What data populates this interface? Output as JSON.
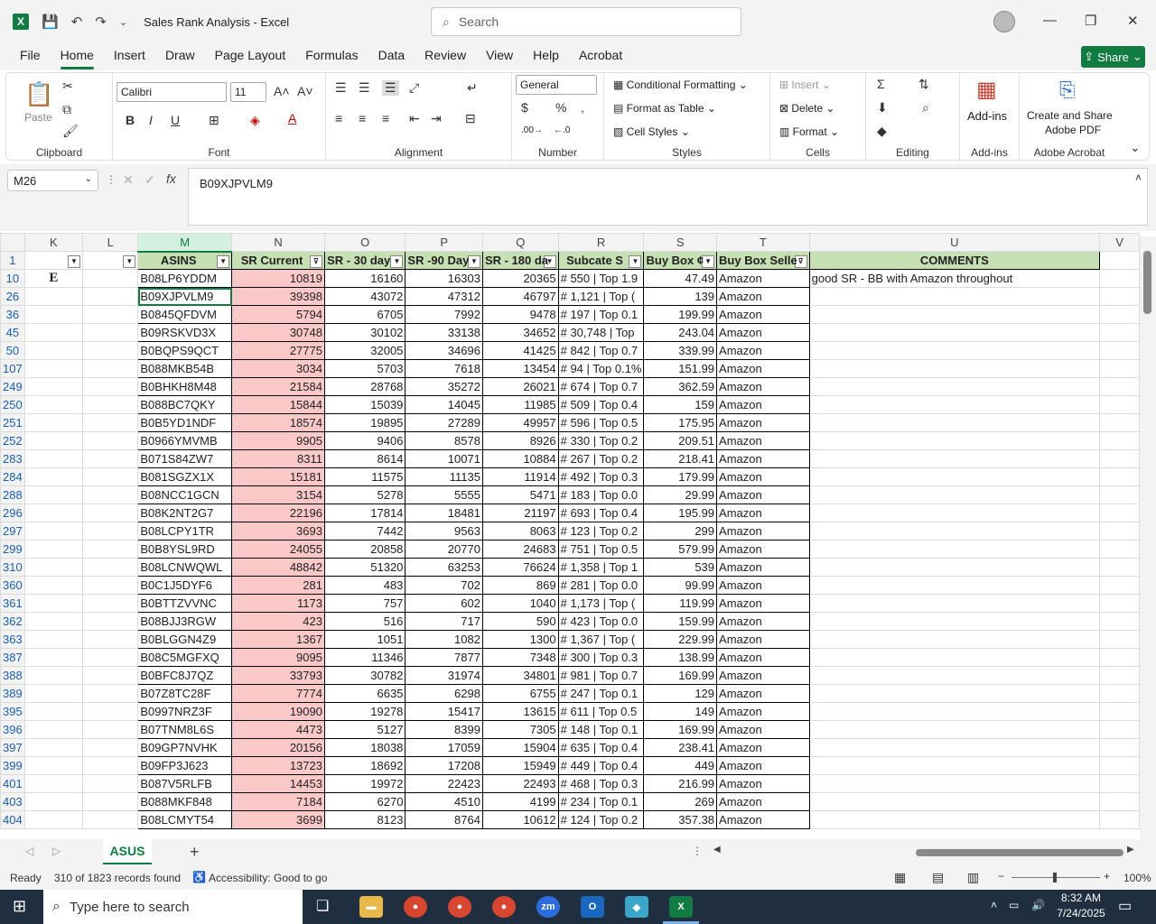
{
  "app": {
    "title": "Sales Rank Analysis  -  Excel",
    "search_placeholder": "Search",
    "share_label": "Share"
  },
  "tabs": [
    "File",
    "Home",
    "Insert",
    "Draw",
    "Page Layout",
    "Formulas",
    "Data",
    "Review",
    "View",
    "Help",
    "Acrobat"
  ],
  "ribbon": {
    "paste": "Paste",
    "clipboard": "Clipboard",
    "font_name": "Calibri",
    "font_size": "11",
    "font_group": "Font",
    "alignment_group": "Alignment",
    "number_format": "General",
    "number_group": "Number",
    "conditional_formatting": "Conditional Formatting",
    "format_as_table": "Format as Table",
    "cell_styles": "Cell Styles",
    "styles_group": "Styles",
    "insert": "Insert",
    "delete": "Delete",
    "format": "Format",
    "cells_group": "Cells",
    "editing_group": "Editing",
    "addins": "Add-ins",
    "addins_group": "Add-ins",
    "create_share_1": "Create and Share",
    "create_share_2": "Adobe PDF",
    "acrobat_group": "Adobe Acrobat"
  },
  "formula": {
    "namebox": "M26",
    "content": "B09XJPVLM9"
  },
  "columns": [
    "K",
    "L",
    "M",
    "N",
    "O",
    "P",
    "Q",
    "R",
    "S",
    "T",
    "U",
    "V"
  ],
  "header_row": {
    "row": "1",
    "asins": "ASINS",
    "sr_current": "SR Current",
    "sr30": "SR - 30 day",
    "sr90": "SR -90 Day",
    "sr180": "SR - 180 da",
    "subcat": "Subcate S",
    "buybox": "Buy Box ¢",
    "seller": "Buy Box Selle",
    "comments": "COMMENTS"
  },
  "rows": [
    {
      "r": "10",
      "k": "E",
      "asin": "B08LP6YDDM",
      "n": "10819",
      "o": "16160",
      "p": "16303",
      "q": "20365",
      "rk": "# 550 | Top 1.9",
      "s": "47.49",
      "t": "Amazon",
      "u": "good SR - BB with Amazon throughout"
    },
    {
      "r": "26",
      "k": "",
      "asin": "B09XJPVLM9",
      "n": "39398",
      "o": "43072",
      "p": "47312",
      "q": "46797",
      "rk": "# 1,121 | Top (",
      "s": "139",
      "t": "Amazon",
      "u": ""
    },
    {
      "r": "36",
      "k": "",
      "asin": "B0845QFDVM",
      "n": "5794",
      "o": "6705",
      "p": "7992",
      "q": "9478",
      "rk": "# 197 | Top 0.1",
      "s": "199.99",
      "t": "Amazon",
      "u": ""
    },
    {
      "r": "45",
      "k": "",
      "asin": "B09RSKVD3X",
      "n": "30748",
      "o": "30102",
      "p": "33138",
      "q": "34652",
      "rk": "# 30,748 | Top",
      "s": "243.04",
      "t": "Amazon",
      "u": ""
    },
    {
      "r": "50",
      "k": "",
      "asin": "B0BQPS9QCT",
      "n": "27775",
      "o": "32005",
      "p": "34696",
      "q": "41425",
      "rk": "# 842 | Top 0.7",
      "s": "339.99",
      "t": "Amazon",
      "u": ""
    },
    {
      "r": "107",
      "k": "",
      "asin": "B088MKB54B",
      "n": "3034",
      "o": "5703",
      "p": "7618",
      "q": "13454",
      "rk": "# 94 | Top 0.1%",
      "s": "151.99",
      "t": "Amazon",
      "u": ""
    },
    {
      "r": "249",
      "k": "",
      "asin": "B0BHKH8M48",
      "n": "21584",
      "o": "28768",
      "p": "35272",
      "q": "26021",
      "rk": "# 674 | Top 0.7",
      "s": "362.59",
      "t": "Amazon",
      "u": ""
    },
    {
      "r": "250",
      "k": "",
      "asin": "B088BC7QKY",
      "n": "15844",
      "o": "15039",
      "p": "14045",
      "q": "11985",
      "rk": "# 509 | Top 0.4",
      "s": "159",
      "t": "Amazon",
      "u": ""
    },
    {
      "r": "251",
      "k": "",
      "asin": "B0B5YD1NDF",
      "n": "18574",
      "o": "19895",
      "p": "27289",
      "q": "49957",
      "rk": "# 596 | Top 0.5",
      "s": "175.95",
      "t": "Amazon",
      "u": ""
    },
    {
      "r": "252",
      "k": "",
      "asin": "B0966YMVMB",
      "n": "9905",
      "o": "9406",
      "p": "8578",
      "q": "8926",
      "rk": "# 330 | Top 0.2",
      "s": "209.51",
      "t": "Amazon",
      "u": ""
    },
    {
      "r": "283",
      "k": "",
      "asin": "B071S84ZW7",
      "n": "8311",
      "o": "8614",
      "p": "10071",
      "q": "10884",
      "rk": "# 267 | Top 0.2",
      "s": "218.41",
      "t": "Amazon",
      "u": ""
    },
    {
      "r": "284",
      "k": "",
      "asin": "B081SGZX1X",
      "n": "15181",
      "o": "11575",
      "p": "11135",
      "q": "11914",
      "rk": "# 492 | Top 0.3",
      "s": "179.99",
      "t": "Amazon",
      "u": ""
    },
    {
      "r": "288",
      "k": "",
      "asin": "B08NCC1GCN",
      "n": "3154",
      "o": "5278",
      "p": "5555",
      "q": "5471",
      "rk": "# 183 | Top 0.0",
      "s": "29.99",
      "t": "Amazon",
      "u": ""
    },
    {
      "r": "296",
      "k": "",
      "asin": "B08K2NT2G7",
      "n": "22196",
      "o": "17814",
      "p": "18481",
      "q": "21197",
      "rk": "# 693 | Top 0.4",
      "s": "195.99",
      "t": "Amazon",
      "u": ""
    },
    {
      "r": "297",
      "k": "",
      "asin": "B08LCPY1TR",
      "n": "3693",
      "o": "7442",
      "p": "9563",
      "q": "8063",
      "rk": "# 123 | Top 0.2",
      "s": "299",
      "t": "Amazon",
      "u": ""
    },
    {
      "r": "299",
      "k": "",
      "asin": "B0B8YSL9RD",
      "n": "24055",
      "o": "20858",
      "p": "20770",
      "q": "24683",
      "rk": "# 751 | Top 0.5",
      "s": "579.99",
      "t": "Amazon",
      "u": ""
    },
    {
      "r": "310",
      "k": "",
      "asin": "B08LCNWQWL",
      "n": "48842",
      "o": "51320",
      "p": "63253",
      "q": "76624",
      "rk": "# 1,358 | Top 1",
      "s": "539",
      "t": "Amazon",
      "u": ""
    },
    {
      "r": "360",
      "k": "",
      "asin": "B0C1J5DYF6",
      "n": "281",
      "o": "483",
      "p": "702",
      "q": "869",
      "rk": "# 281 | Top 0.0",
      "s": "99.99",
      "t": "Amazon",
      "u": ""
    },
    {
      "r": "361",
      "k": "",
      "asin": "B0BTTZVVNC",
      "n": "1173",
      "o": "757",
      "p": "602",
      "q": "1040",
      "rk": "# 1,173 | Top (",
      "s": "119.99",
      "t": "Amazon",
      "u": ""
    },
    {
      "r": "362",
      "k": "",
      "asin": "B08BJJ3RGW",
      "n": "423",
      "o": "516",
      "p": "717",
      "q": "590",
      "rk": "# 423 | Top 0.0",
      "s": "159.99",
      "t": "Amazon",
      "u": ""
    },
    {
      "r": "363",
      "k": "",
      "asin": "B0BLGGN4Z9",
      "n": "1367",
      "o": "1051",
      "p": "1082",
      "q": "1300",
      "rk": "# 1,367 | Top (",
      "s": "229.99",
      "t": "Amazon",
      "u": ""
    },
    {
      "r": "387",
      "k": "",
      "asin": "B08C5MGFXQ",
      "n": "9095",
      "o": "11346",
      "p": "7877",
      "q": "7348",
      "rk": "# 300 | Top 0.3",
      "s": "138.99",
      "t": "Amazon",
      "u": ""
    },
    {
      "r": "388",
      "k": "",
      "asin": "B0BFC8J7QZ",
      "n": "33793",
      "o": "30782",
      "p": "31974",
      "q": "34801",
      "rk": "# 981 | Top 0.7",
      "s": "169.99",
      "t": "Amazon",
      "u": ""
    },
    {
      "r": "389",
      "k": "",
      "asin": "B07Z8TC28F",
      "n": "7774",
      "o": "6635",
      "p": "6298",
      "q": "6755",
      "rk": "# 247 | Top 0.1",
      "s": "129",
      "t": "Amazon",
      "u": ""
    },
    {
      "r": "395",
      "k": "",
      "asin": "B0997NRZ3F",
      "n": "19090",
      "o": "19278",
      "p": "15417",
      "q": "13615",
      "rk": "# 611 | Top 0.5",
      "s": "149",
      "t": "Amazon",
      "u": ""
    },
    {
      "r": "396",
      "k": "",
      "asin": "B07TNM8L6S",
      "n": "4473",
      "o": "5127",
      "p": "8399",
      "q": "7305",
      "rk": "# 148 | Top 0.1",
      "s": "169.99",
      "t": "Amazon",
      "u": ""
    },
    {
      "r": "397",
      "k": "",
      "asin": "B09GP7NVHK",
      "n": "20156",
      "o": "18038",
      "p": "17059",
      "q": "15904",
      "rk": "# 635 | Top 0.4",
      "s": "238.41",
      "t": "Amazon",
      "u": ""
    },
    {
      "r": "399",
      "k": "",
      "asin": "B09FP3J623",
      "n": "13723",
      "o": "18692",
      "p": "17208",
      "q": "15949",
      "rk": "# 449 | Top 0.4",
      "s": "449",
      "t": "Amazon",
      "u": ""
    },
    {
      "r": "401",
      "k": "",
      "asin": "B087V5RLFB",
      "n": "14453",
      "o": "19972",
      "p": "22423",
      "q": "22493",
      "rk": "# 468 | Top 0.3",
      "s": "216.99",
      "t": "Amazon",
      "u": ""
    },
    {
      "r": "403",
      "k": "",
      "asin": "B088MKF848",
      "n": "7184",
      "o": "6270",
      "p": "4510",
      "q": "4199",
      "rk": "# 234 | Top 0.1",
      "s": "269",
      "t": "Amazon",
      "u": ""
    },
    {
      "r": "404",
      "k": "",
      "asin": "B08LCMYT54",
      "n": "3699",
      "o": "8123",
      "p": "8764",
      "q": "10612",
      "rk": "# 124 | Top 0.2",
      "s": "357.38",
      "t": "Amazon",
      "u": ""
    }
  ],
  "sheet": {
    "name": "ASUS"
  },
  "status": {
    "ready": "Ready",
    "records": "310 of 1823 records found",
    "accessibility": "Accessibility: Good to go",
    "zoom": "100%"
  },
  "taskbar": {
    "search_placeholder": "Type here to search",
    "time": "8:32 AM",
    "date": "7/24/2025"
  },
  "colors": {
    "accent": "#107c41",
    "header_fill": "#c6e0b4",
    "sr_fill": "#fbc8c8"
  }
}
